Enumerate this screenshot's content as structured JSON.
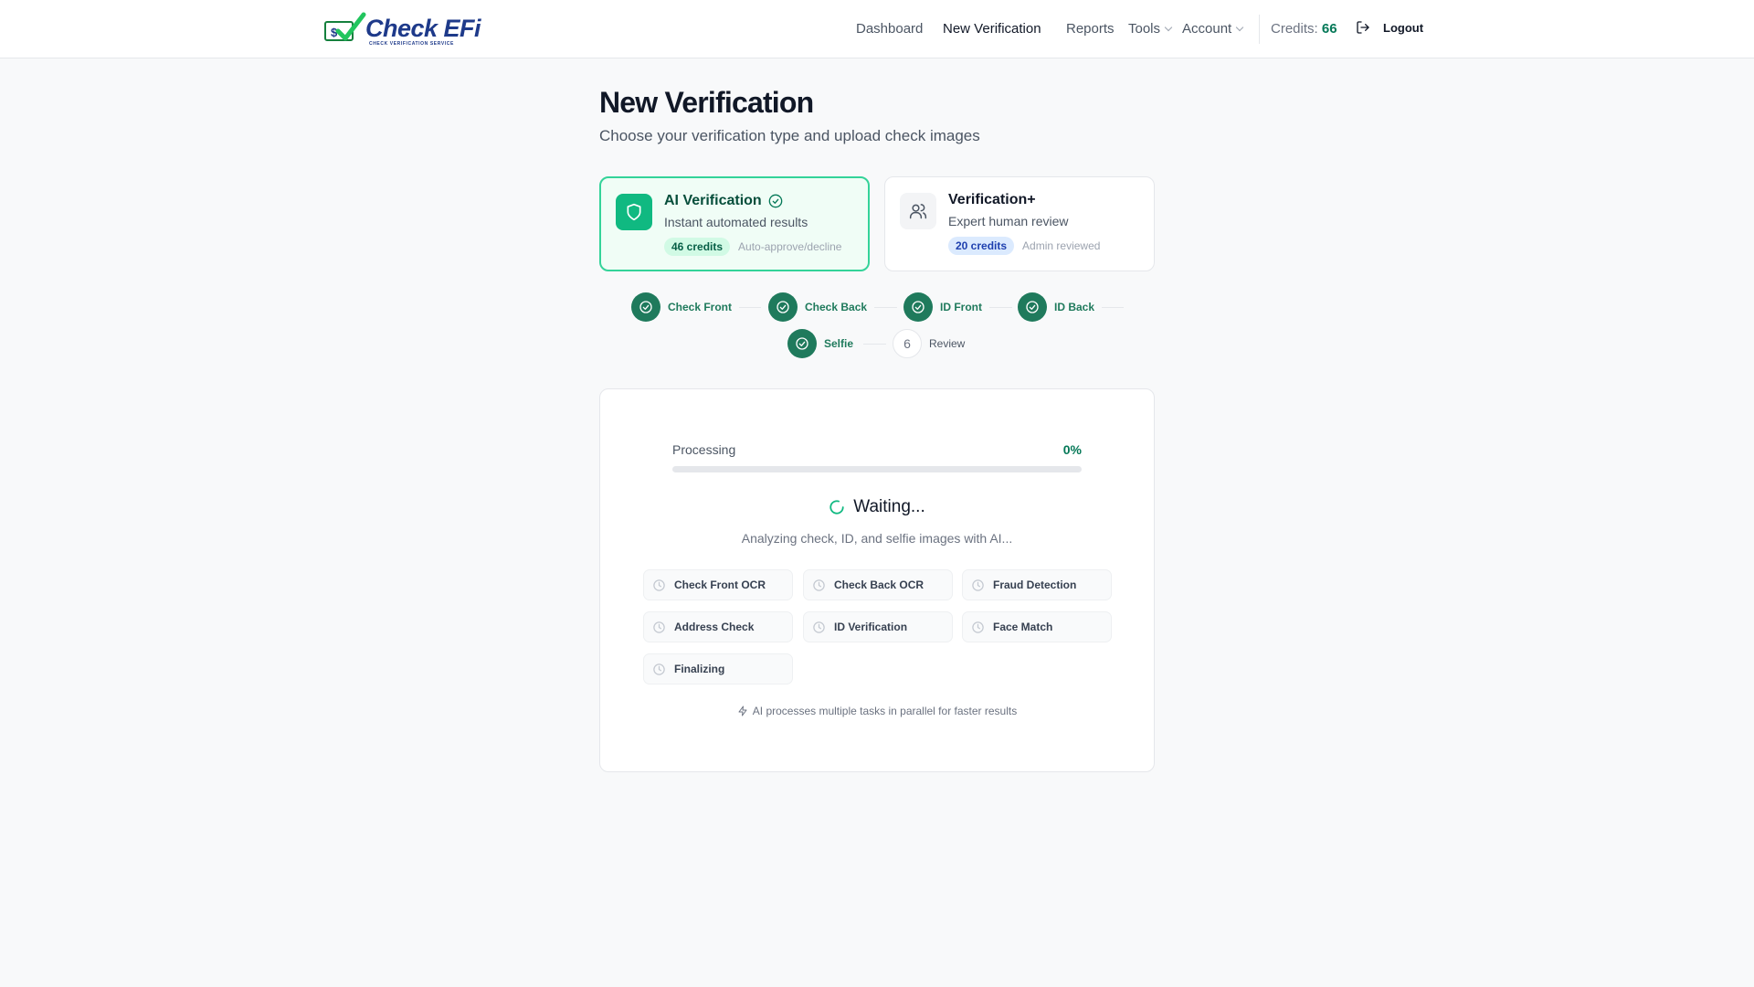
{
  "header": {
    "logo_text": "Check EFi",
    "logo_subtext": "CHECK VERIFICATION SERVICE",
    "nav": {
      "dashboard": "Dashboard",
      "new_verification": "New Verification",
      "reports": "Reports",
      "tools": "Tools",
      "account": "Account"
    },
    "credits_label": "Credits:",
    "credits_value": "66",
    "logout_label": "Logout"
  },
  "page": {
    "title": "New Verification",
    "subtitle": "Choose your verification type and upload check images"
  },
  "verification_types": {
    "ai": {
      "title": "AI Verification",
      "description": "Instant automated results",
      "credits": "46 credits",
      "note": "Auto-approve/decline",
      "icon": "shield-icon",
      "selected": true
    },
    "plus": {
      "title": "Verification+",
      "description": "Expert human review",
      "credits": "20 credits",
      "note": "Admin reviewed",
      "icon": "users-icon",
      "selected": false
    }
  },
  "steps": {
    "check_front": "Check Front",
    "check_back": "Check Back",
    "id_front": "ID Front",
    "id_back": "ID Back",
    "selfie": "Selfie",
    "review_number": "6",
    "review": "Review"
  },
  "processing": {
    "label": "Processing",
    "percent": "0%",
    "progress_fraction": 0,
    "status": "Waiting...",
    "description": "Analyzing check, ID, and selfie images with AI...",
    "tasks": {
      "check_front_ocr": "Check Front OCR",
      "check_back_ocr": "Check Back OCR",
      "fraud_detection": "Fraud Detection",
      "address_check": "Address Check",
      "id_verification": "ID Verification",
      "face_match": "Face Match",
      "finalizing": "Finalizing"
    },
    "footnote": "AI processes multiple tasks in parallel for faster results"
  },
  "colors": {
    "brand_green": "#10b981",
    "step_green": "#1f7a5c",
    "navy": "#1e3a8a"
  }
}
